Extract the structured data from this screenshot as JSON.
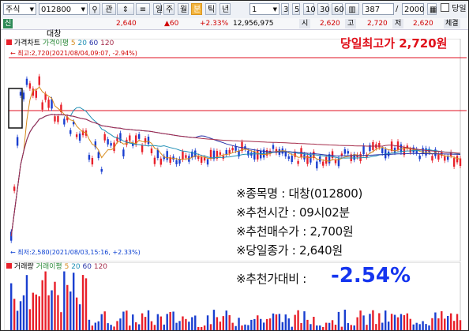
{
  "toolbar": {
    "market": "주식",
    "code": "012800",
    "gwan": "관",
    "period_buttons": [
      "일",
      "주",
      "월",
      "분",
      "틱",
      "년"
    ],
    "active_period": "분",
    "interval": "1",
    "interval_options": [
      "3",
      "5",
      "10",
      "30",
      "60"
    ],
    "count": "387",
    "count_max": "2000",
    "day_label": "당일"
  },
  "quote": {
    "tag": "신",
    "name": "대창",
    "price": "2,640",
    "change": "▲60",
    "change_pct": "+2.33%",
    "volume": "12,956,975",
    "open_label": "시",
    "open": "2,620",
    "high_label": "고",
    "high": "2,720",
    "low_label": "저",
    "low": "2,620",
    "tail": "체결"
  },
  "chart": {
    "price_legend": {
      "name": "가격차트",
      "ma_label": "가격이평",
      "ma": [
        "5",
        "20",
        "60",
        "120"
      ]
    },
    "volume_legend": {
      "name": "거래량",
      "ma_label": "거래이평",
      "ma": [
        "5",
        "20",
        "60",
        "120"
      ]
    },
    "high_note": "최고:2,720(2021/08/04,09:07, -2.94%)",
    "low_note": "최저:2,580(2021/08/03,15:16, +2.33%)",
    "colors": {
      "up": "#e8202a",
      "down": "#1a3fd0",
      "ma5": "#d68a1c",
      "ma20": "#1f8fb5",
      "ma60": "#2732a8",
      "ma120": "#a52c4a"
    }
  },
  "annotation": {
    "headline": "당일최고가 2,720원",
    "lines": [
      "※종목명 : 대창(012800)",
      "※추천시간 : 09시02분",
      "※추천매수가 : 2,700원",
      "※당일종가 : 2,640원"
    ],
    "ratio_label": "※추천가대비 :",
    "ratio_value": "-2.54%"
  }
}
